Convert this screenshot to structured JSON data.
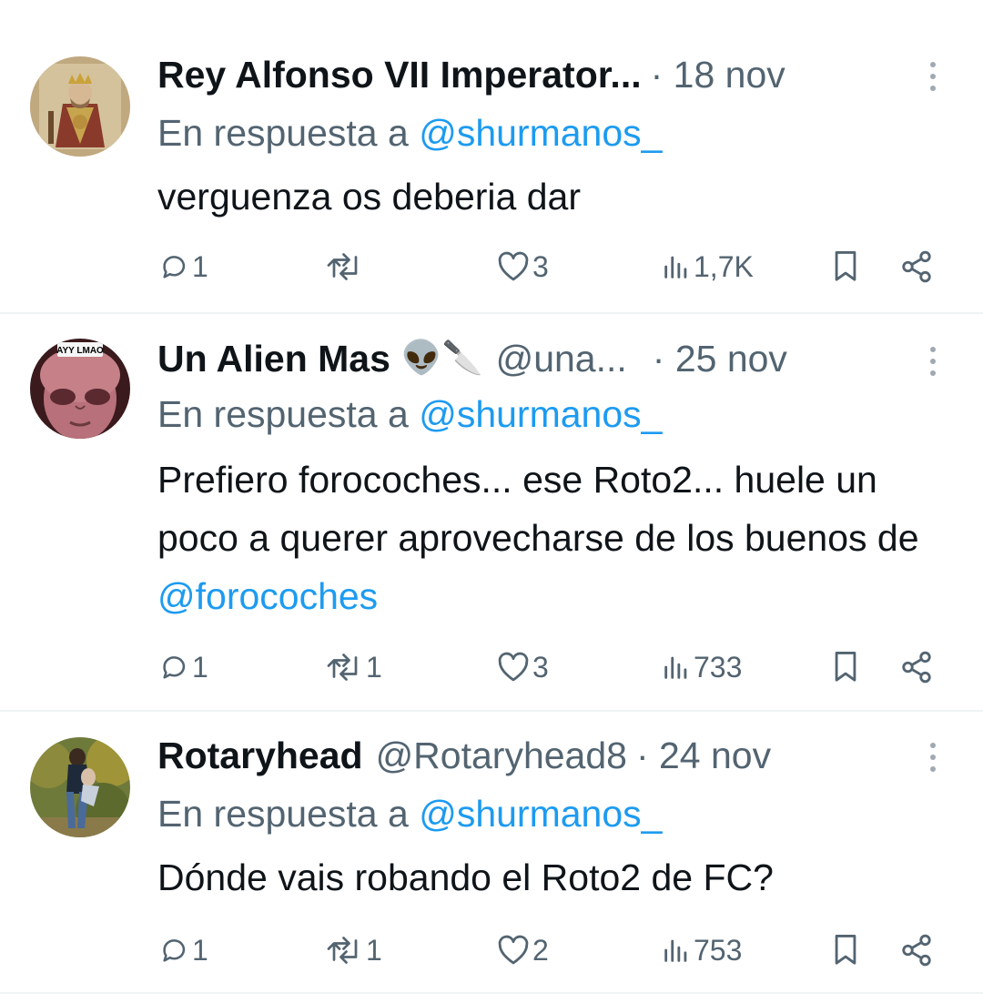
{
  "tweets": [
    {
      "name": "Rey Alfonso VII Imperator...",
      "emoji": "",
      "handle": "",
      "time": "· 18 nov",
      "reply_prefix": "En respuesta a",
      "reply_handle": "@shurmanos_",
      "text": "verguenza os deberia dar",
      "mention": "",
      "counts": {
        "replies": "1",
        "retweets": "",
        "likes": "3",
        "views": "1,7K"
      },
      "avatar": "medieval-king-portrait"
    },
    {
      "name": "Un Alien Mas",
      "emoji": "👽🔪",
      "handle": "@una...",
      "time": "· 25 nov",
      "reply_prefix": "En respuesta a",
      "reply_handle": "@shurmanos_",
      "text": "Prefiero forocoches... ese Roto2... huele un poco a querer aprovecharse de los buenos de",
      "mention": "@forocoches",
      "avatar_label": "AYY LMAO",
      "counts": {
        "replies": "1",
        "retweets": "1",
        "likes": "3",
        "views": "733"
      },
      "avatar": "alien-face"
    },
    {
      "name": "Rotaryhead",
      "emoji": "",
      "handle": "@Rotaryhead8",
      "time": "· 24 nov",
      "reply_prefix": "En respuesta a",
      "reply_handle": "@shurmanos_",
      "text": "Dónde vais robando el Roto2 de FC?",
      "mention": "",
      "counts": {
        "replies": "1",
        "retweets": "1",
        "likes": "2",
        "views": "753"
      },
      "avatar": "couple-outdoor-photo"
    }
  ],
  "icons": {
    "reply": "reply-icon",
    "retweet": "retweet-icon",
    "like": "like-icon",
    "views": "views-icon",
    "bookmark": "bookmark-icon",
    "share": "share-icon",
    "more": "more-icon"
  },
  "colors": {
    "text": "#0f1419",
    "secondary": "#536471",
    "link": "#1d9bf0",
    "divider": "#eff3f4"
  }
}
